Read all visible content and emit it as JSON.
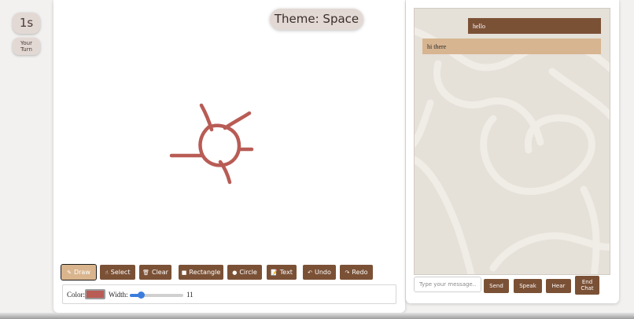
{
  "timer": {
    "value": "1s"
  },
  "turn": {
    "line1": "Your",
    "line2": "Turn"
  },
  "canvas": {
    "theme_label": "Theme: Space",
    "stroke_color": "#b85c55",
    "toolbar": [
      {
        "key": "draw",
        "icon": "pencil-icon",
        "glyph": "✎",
        "label": "Draw",
        "active": true
      },
      {
        "key": "select",
        "icon": "pointer-icon",
        "glyph": "☝",
        "label": "Select",
        "active": false
      },
      {
        "key": "clear",
        "icon": "trash-icon",
        "glyph": "🗑",
        "label": "Clear",
        "active": false
      },
      {
        "key": "rectangle",
        "icon": "square-icon",
        "glyph": "■",
        "label": "Rectangle",
        "active": false
      },
      {
        "key": "circle",
        "icon": "circle-icon",
        "glyph": "●",
        "label": "Circle",
        "active": false
      },
      {
        "key": "text",
        "icon": "memo-icon",
        "glyph": "📝",
        "label": "Text",
        "active": false
      },
      {
        "key": "undo",
        "icon": "undo-icon",
        "glyph": "↶",
        "label": "Undo",
        "active": false
      },
      {
        "key": "redo",
        "icon": "redo-icon",
        "glyph": "↷",
        "label": "Redo",
        "active": false
      }
    ],
    "options": {
      "color_label": "Color:",
      "color_value": "#b85c55",
      "width_label": "Width:",
      "width_value": "11",
      "width_min": 1,
      "width_max": 50
    }
  },
  "chat": {
    "messages": [
      {
        "from": "me",
        "text": "hello"
      },
      {
        "from": "them",
        "text": "hi there"
      }
    ],
    "input_placeholder": "Type your message...",
    "send_label": "Send",
    "speak_label": "Speak",
    "hear_label": "Hear",
    "end_label_1": "End",
    "end_label_2": "Chat"
  }
}
